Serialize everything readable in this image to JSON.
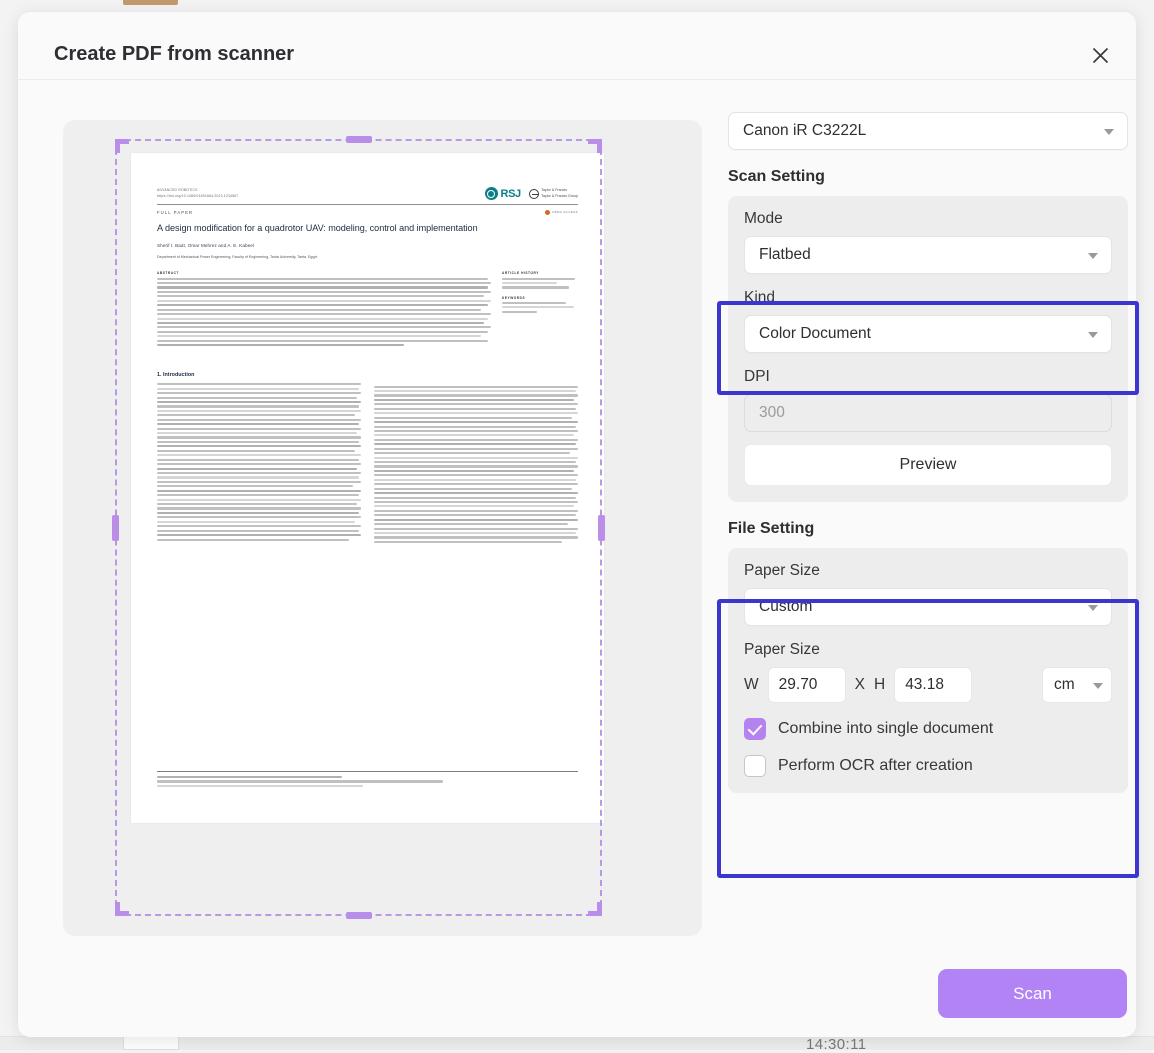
{
  "window": {
    "title": "Create PDF from scanner",
    "close_icon": "close-icon",
    "clock": "14:30:11"
  },
  "preview": {
    "document": {
      "journal_meta_line1": "ADVANCED ROBOTICS",
      "journal_meta_line2": "https://doi.org/10.1080/01691864.2023.1234567",
      "publisher_rsj": "RSJ",
      "publisher_tf_line1": "Taylor & Francis",
      "publisher_tf_line2": "Taylor & Francis Group",
      "paper_type": "FULL PAPER",
      "open_access": "OPEN ACCESS",
      "title": "A design modification for a quadrotor UAV: modeling, control and implementation",
      "authors": "Sherif I. Badr, Omar Mehrez and A. E. Kabeel",
      "affiliation": "Department of Mechanical Power Engineering, Faculty of Engineering, Tanta University, Tanta, Egypt",
      "abstract_heading": "ABSTRACT",
      "article_history_heading": "ARTICLE HISTORY",
      "keywords_heading": "KEYWORDS",
      "section_1_heading": "1. Introduction"
    },
    "crop_selection": {
      "handle_color": "#b98ee8",
      "border_color": "#b79ae0"
    }
  },
  "settings": {
    "scanner_device": {
      "label": "Canon iR C3222L",
      "caret_icon": "chevron-down-icon"
    },
    "scan_setting": {
      "heading": "Scan Setting",
      "mode": {
        "label": "Mode",
        "value": "Flatbed"
      },
      "kind": {
        "label": "Kind",
        "value": "Color Document"
      },
      "dpi": {
        "label": "DPI",
        "value": "",
        "placeholder": "300"
      },
      "preview_button": "Preview"
    },
    "file_setting": {
      "heading": "File Setting",
      "paper_size_preset": {
        "label": "Paper Size",
        "value": "Custom"
      },
      "paper_size_custom": {
        "label": "Paper Size",
        "width_label": "W",
        "width_value": "29.70",
        "times_label": "X",
        "height_label": "H",
        "height_value": "43.18",
        "unit_value": "cm"
      },
      "combine": {
        "label": "Combine into single document",
        "checked": true
      },
      "ocr": {
        "label": "Perform OCR after creation",
        "checked": false
      }
    },
    "highlight_color": "#3b36cd"
  },
  "actions": {
    "scan_button": "Scan",
    "scan_button_color": "#b183f4"
  }
}
